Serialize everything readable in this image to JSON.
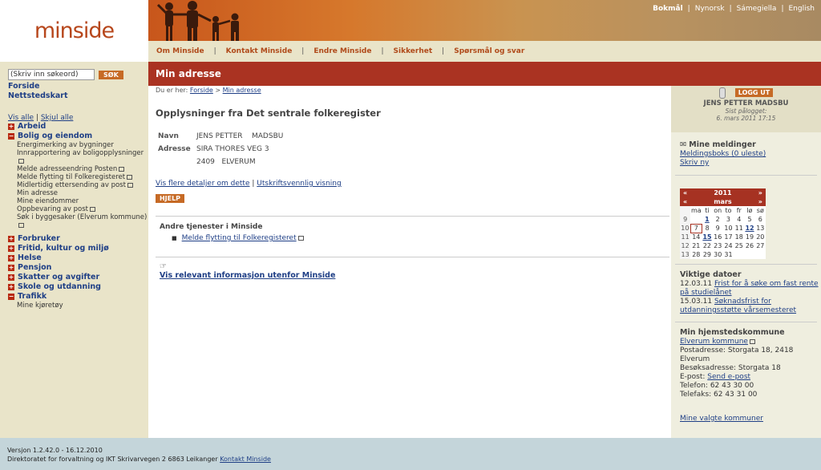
{
  "logo": "minside",
  "languages": [
    "Bokmål",
    "Nynorsk",
    "Sámegiella",
    "English"
  ],
  "topnav": [
    "Om Minside",
    "Kontakt Minside",
    "Endre Minside",
    "Sikkerhet",
    "Spørsmål og svar"
  ],
  "search": {
    "placeholder": "(Skriv inn søkeord)",
    "button": "SØK"
  },
  "left_links": [
    "Forside",
    "Nettstedskart"
  ],
  "vis_alle": "Vis alle",
  "skjul_alle": "Skjul alle",
  "categories": [
    {
      "label": "Arbeid",
      "expanded": false,
      "items": []
    },
    {
      "label": "Bolig og eiendom",
      "expanded": true,
      "items": [
        {
          "label": "Energimerking av bygninger",
          "ext": false
        },
        {
          "label": "Innrapportering av boligopplysninger",
          "ext": true
        },
        {
          "label": "Melde adresseendring Posten",
          "ext": true
        },
        {
          "label": "Melde flytting til Folkeregisteret",
          "ext": true
        },
        {
          "label": "Midlertidig ettersending av post",
          "ext": true
        },
        {
          "label": "Min adresse",
          "ext": false
        },
        {
          "label": "Mine eiendommer",
          "ext": false
        },
        {
          "label": "Oppbevaring av post",
          "ext": true
        },
        {
          "label": "Søk i byggesaker (Elverum kommune)",
          "ext": true
        }
      ]
    },
    {
      "label": "Forbruker",
      "expanded": false,
      "items": []
    },
    {
      "label": "Fritid, kultur og miljø",
      "expanded": false,
      "items": []
    },
    {
      "label": "Helse",
      "expanded": false,
      "items": []
    },
    {
      "label": "Pensjon",
      "expanded": false,
      "items": []
    },
    {
      "label": "Skatter og avgifter",
      "expanded": false,
      "items": []
    },
    {
      "label": "Skole og utdanning",
      "expanded": false,
      "items": []
    },
    {
      "label": "Trafikk",
      "expanded": true,
      "items": [
        {
          "label": "Mine kjøretøy",
          "ext": false
        }
      ]
    }
  ],
  "page_title": "Min adresse",
  "breadcrumb": {
    "prefix": "Du er her:",
    "items": [
      "Forside",
      "Min adresse"
    ],
    "sep": ">"
  },
  "heading": "Opplysninger fra Det sentrale folkeregister",
  "info": {
    "navn_label": "Navn",
    "first": "JENS PETTER",
    "last": "MADSBU",
    "adresse_label": "Adresse",
    "street": "SIRA THORES VEG 3",
    "postcode": "2409",
    "city": "ELVERUM"
  },
  "links": {
    "details": "Vis flere detaljer om dette",
    "sep": "|",
    "print": "Utskriftsvennlig visning"
  },
  "help_button": "HJELP",
  "andre": {
    "title": "Andre tjenester i Minside",
    "items": [
      "Melde flytting til Folkeregisteret"
    ]
  },
  "vis_relevant": "Vis relevant informasjon utenfor Minside",
  "user": {
    "logout": "LOGG UT",
    "name": "JENS PETTER MADSBU",
    "last_login_label": "Sist pålogget:",
    "last_login": "6. mars 2011 17:15"
  },
  "messages": {
    "title": "Mine meldinger",
    "inbox": "Meldingsboks (0 uleste)",
    "write": "Skriv ny"
  },
  "calendar": {
    "year": "2011",
    "month": "mars",
    "prev": "«",
    "next": "»",
    "days": [
      "ma",
      "ti",
      "on",
      "to",
      "fr",
      "lø",
      "sø"
    ],
    "weeks": [
      {
        "wk": "9",
        "d": [
          "",
          "1",
          "2",
          "3",
          "4",
          "5",
          "6"
        ]
      },
      {
        "wk": "10",
        "d": [
          "7",
          "8",
          "9",
          "10",
          "11",
          "12",
          "13"
        ]
      },
      {
        "wk": "11",
        "d": [
          "14",
          "15",
          "16",
          "17",
          "18",
          "19",
          "20"
        ]
      },
      {
        "wk": "12",
        "d": [
          "21",
          "22",
          "23",
          "24",
          "25",
          "26",
          "27"
        ]
      },
      {
        "wk": "13",
        "d": [
          "28",
          "29",
          "30",
          "31",
          "",
          "",
          ""
        ]
      }
    ],
    "bold_days": [
      "1",
      "12",
      "15"
    ],
    "today": "7"
  },
  "dates": {
    "title": "Viktige datoer",
    "items": [
      {
        "date": "12.03.11",
        "text": "Frist for å søke om fast rente på studielånet"
      },
      {
        "date": "15.03.11",
        "text": "Søknadsfrist for utdanningsstøtte vårsemesteret"
      }
    ]
  },
  "kommune": {
    "title": "Min hjemstedskommune",
    "name": "Elverum kommune",
    "post": "Postadresse: Storgata 18, 2418 Elverum",
    "besok": "Besøksadresse: Storgata 18",
    "email_label": "E-post:",
    "email": "Send e-post",
    "tlf": "Telefon: 62 43 30 00",
    "fax": "Telefaks: 62 43 31 00",
    "valgte": "Mine valgte kommuner"
  },
  "footer": {
    "version": "Versjon 1.2.42.0 - 16.12.2010",
    "org": "Direktoratet for forvaltning og IKT Skrivarvegen 2 6863 Leikanger",
    "contact": "Kontakt Minside"
  }
}
